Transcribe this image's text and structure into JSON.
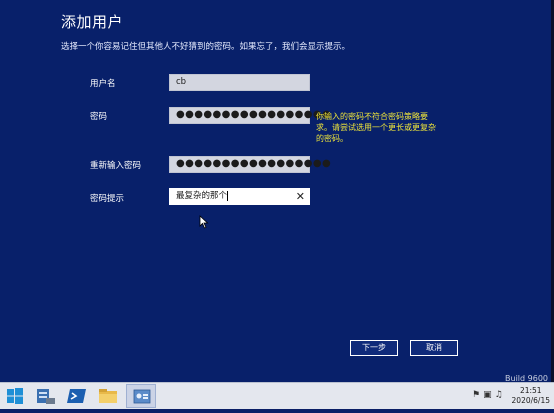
{
  "dialog": {
    "title": "添加用户",
    "subtitle": "选择一个你容易记住但其他人不好猜到的密码。如果忘了，我们会显示提示。"
  },
  "form": {
    "username_label": "用户名",
    "username_value": "cb",
    "password_label": "密码",
    "password_value": "●●●●●●●●●●●●●●●●●",
    "password_warning": "你输入的密码不符合密码策略要求。请尝试选用一个更长或更复杂的密码。",
    "confirm_label": "重新输入密码",
    "confirm_value": "●●●●●●●●●●●●●●●●●",
    "hint_label": "密码提示",
    "hint_value": "最复杂的那个"
  },
  "buttons": {
    "next": "下一步",
    "cancel": "取消"
  },
  "watermark": "Build 9600",
  "taskbar": {
    "time": "21:51",
    "date": "2020/6/15",
    "icons": [
      "windows-start-icon",
      "server-manager-icon",
      "powershell-icon",
      "file-explorer-icon",
      "control-panel-icon"
    ]
  },
  "colors": {
    "background": "#08206a",
    "warning": "#f0e63a",
    "field": "#d3d6e0",
    "taskbar": "#e4e7ee",
    "accent": "#1e8fd6"
  }
}
